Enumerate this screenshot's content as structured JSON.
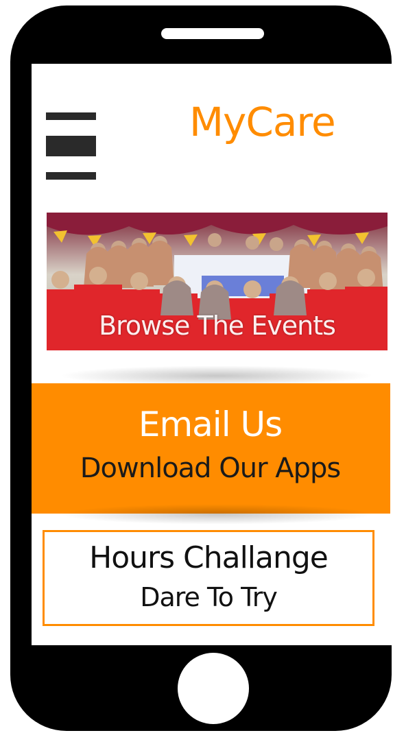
{
  "header": {
    "title": "MyCare",
    "menu_icon": "hamburger-menu-icon"
  },
  "banner": {
    "label": "Browse The Events",
    "image": "group-photo"
  },
  "orange_block": {
    "email_label": "Email Us",
    "apps_label": "Download Our Apps"
  },
  "challenge": {
    "title": "Hours Challange",
    "subtitle": "Dare To Try"
  },
  "colors": {
    "accent": "#ff8c00",
    "phone_body": "#000000",
    "screen": "#ffffff"
  }
}
